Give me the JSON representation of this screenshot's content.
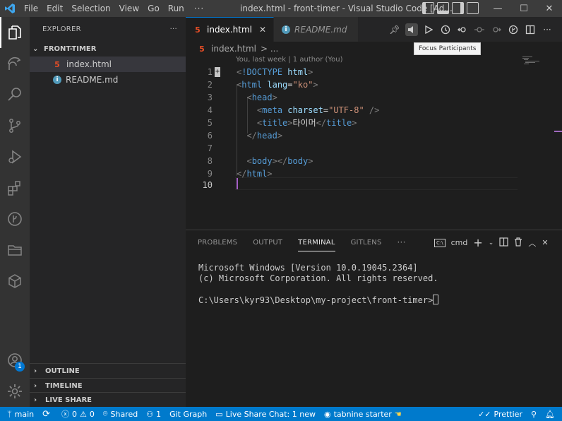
{
  "titlebar": {
    "menus": [
      "File",
      "Edit",
      "Selection",
      "View",
      "Go",
      "Run"
    ],
    "more": "···",
    "window_title": "index.html - front-timer - Visual Studio Code [Ad..."
  },
  "activitybar": {
    "accounts_badge": "1"
  },
  "explorer": {
    "header": "EXPLORER",
    "more": "···",
    "folder": "FRONT-TIMER",
    "files": [
      {
        "name": "index.html",
        "icon": "html5-icon"
      },
      {
        "name": "README.md",
        "icon": "info-icon"
      }
    ],
    "sections": [
      "OUTLINE",
      "TIMELINE",
      "LIVE SHARE"
    ]
  },
  "tabs": [
    {
      "label": "index.html",
      "active": true
    },
    {
      "label": "README.md",
      "active": false
    }
  ],
  "tooltip": "Focus Participants",
  "breadcrumb": {
    "file": "index.html",
    "more": "> ..."
  },
  "editor": {
    "blame": "You, last week | 1 author (You)",
    "line_numbers": [
      "1",
      "2",
      "3",
      "4",
      "5",
      "6",
      "7",
      "8",
      "9",
      "10"
    ],
    "current_line": "10"
  },
  "panel": {
    "tabs": [
      "PROBLEMS",
      "OUTPUT",
      "TERMINAL",
      "GITLENS"
    ],
    "active_tab": "TERMINAL",
    "more": "···",
    "shell": "cmd",
    "terminal_lines": [
      "Microsoft Windows [Version 10.0.19045.2364]",
      "(c) Microsoft Corporation. All rights reserved.",
      "",
      "C:\\Users\\kyr93\\Desktop\\my-project\\front-timer>"
    ]
  },
  "statusbar": {
    "branch": "main",
    "errors": "0",
    "warnings": "0",
    "shared": "Shared",
    "ports": "1",
    "git_graph": "Git Graph",
    "live_share_chat": "Live Share Chat: 1 new",
    "tabnine": "tabnine starter",
    "prettier": "Prettier"
  },
  "colors": {
    "accent": "#007acc",
    "titlebar": "#3c3c3c",
    "sidebar": "#252526",
    "editor": "#1e1e1e"
  }
}
